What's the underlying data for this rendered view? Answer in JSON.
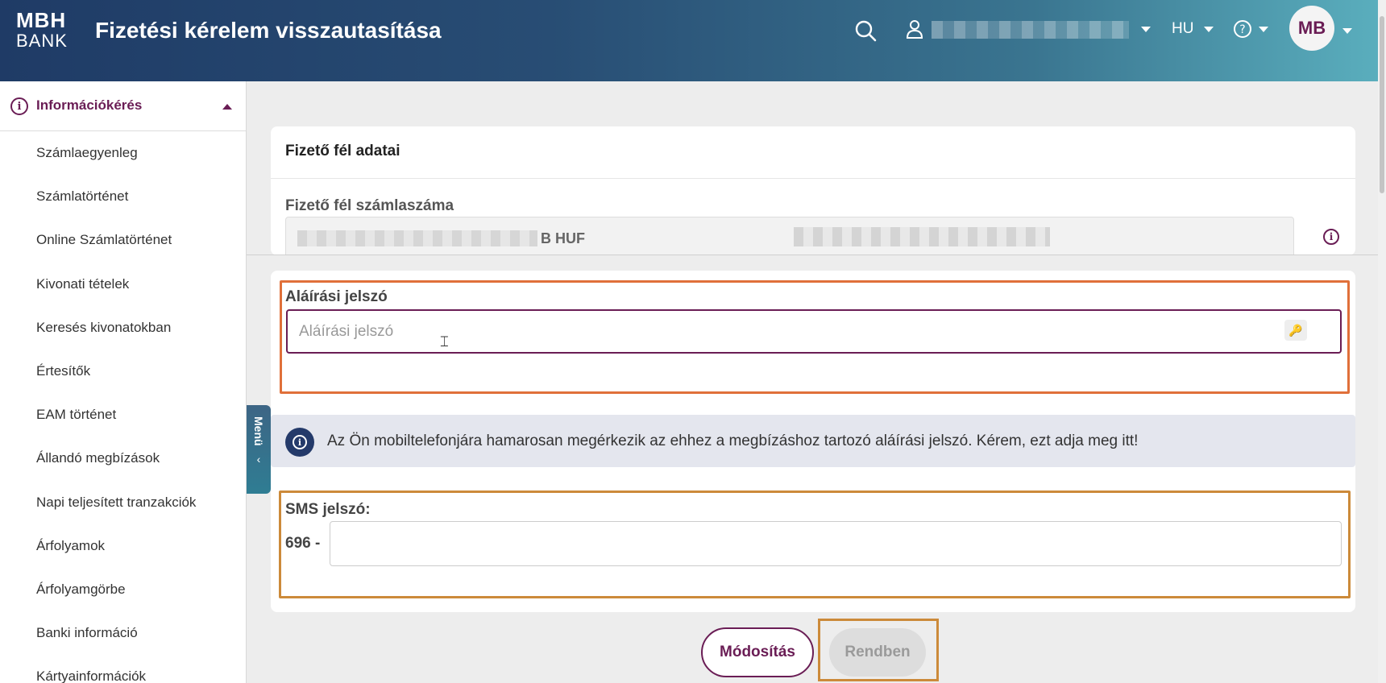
{
  "header": {
    "logo_top": "MBH",
    "logo_bottom": "BANK",
    "title": "Fizetési kérelem visszautasítása",
    "language": "HU",
    "avatar_initials": "MB",
    "icons": [
      "search-icon",
      "user-icon",
      "chevron-down-icon",
      "help-icon"
    ]
  },
  "sidebar": {
    "section_label": "Információkérés",
    "items": [
      {
        "label": "Számlaegyenleg"
      },
      {
        "label": "Számlatörténet"
      },
      {
        "label": "Online Számlatörténet"
      },
      {
        "label": "Kivonati tételek"
      },
      {
        "label": "Keresés kivonatokban"
      },
      {
        "label": "Értesítők"
      },
      {
        "label": "EAM történet"
      },
      {
        "label": "Állandó megbízások"
      },
      {
        "label": "Napi teljesített tranzakciók"
      },
      {
        "label": "Árfolyamok"
      },
      {
        "label": "Árfolyamgörbe"
      },
      {
        "label": "Banki információ"
      },
      {
        "label": "Kártyainformációk"
      }
    ],
    "menu_tab_label": "Menü"
  },
  "payer": {
    "section_title": "Fizető fél adatai",
    "account_label": "Fizető fél számlaszáma",
    "account_currency": "B HUF"
  },
  "signature": {
    "label": "Aláírási jelszó",
    "placeholder": "Aláírási jelszó",
    "value": ""
  },
  "notice": {
    "text": "Az Ön mobiltelefonjára hamarosan megérkezik az ehhez a megbízáshoz tartozó aláírási jelszó. Kérem, ezt adja meg itt!"
  },
  "sms": {
    "label": "SMS jelszó:",
    "prefix": "696 -",
    "value": ""
  },
  "buttons": {
    "modify": "Módosítás",
    "ok": "Rendben"
  },
  "colors": {
    "brand_purple": "#6a1d55",
    "header_start": "#1f3b66",
    "header_end": "#5aaebd",
    "highlight_orange": "#e0703a"
  }
}
